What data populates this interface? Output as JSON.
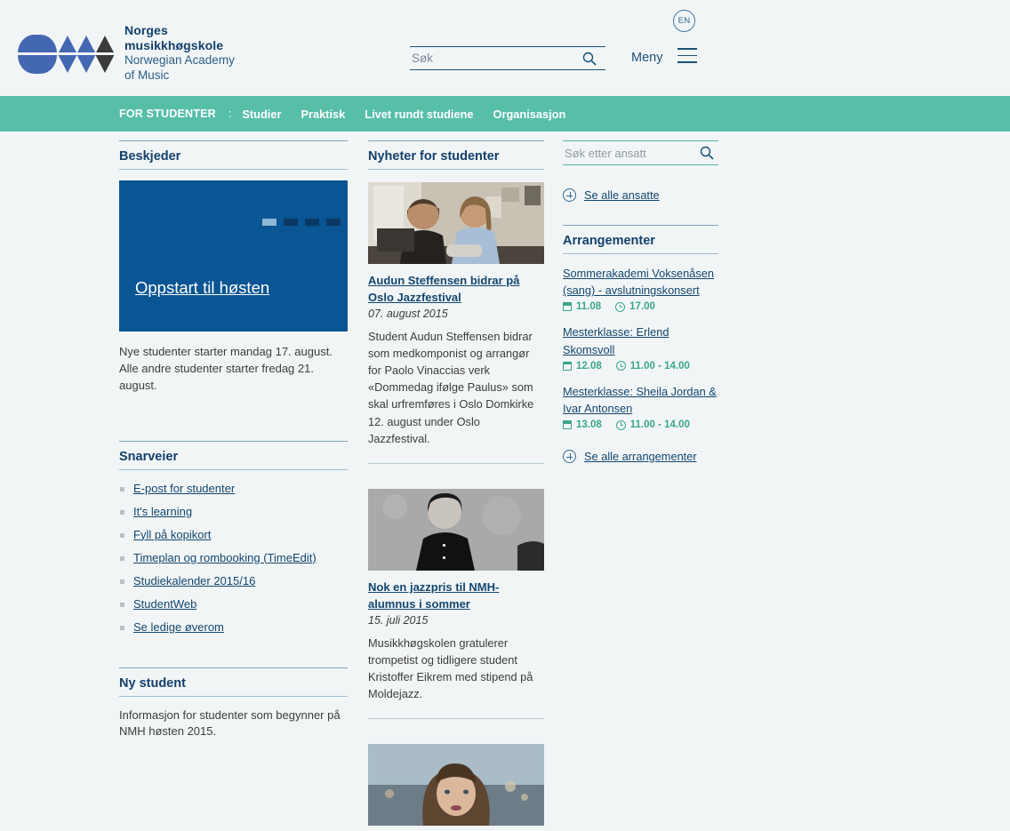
{
  "header": {
    "logo": {
      "line1": "Norges",
      "line2": "musikkhøgskole",
      "line3": "Norwegian Academy",
      "line4": "of Music",
      "mark_icon": "nmh-logo-icon"
    },
    "search": {
      "placeholder": "Søk",
      "value": "",
      "icon": "search-icon"
    },
    "menu_label": "Meny",
    "menu_icon": "hamburger-icon",
    "language_badge": "EN"
  },
  "navbar": {
    "section_title": "FOR STUDENTER",
    "separator": ":",
    "items": [
      {
        "label": "Studier"
      },
      {
        "label": "Praktisk"
      },
      {
        "label": "Livet rundt studiene"
      },
      {
        "label": "Organisasjon"
      }
    ]
  },
  "left": {
    "messages_heading": "Beskjeder",
    "promo": {
      "link_text": "Oppstart til høsten",
      "slides": 4,
      "active_slide": 1,
      "description": "Nye studenter starter mandag 17. august. Alle andre studenter starter fredag 21. august."
    },
    "shortcuts_heading": "Snarveier",
    "shortcuts": [
      {
        "label": "E-post for studenter"
      },
      {
        "label": "It's learning"
      },
      {
        "label": "Fyll på kopikort"
      },
      {
        "label": "Timeplan og rombooking (TimeEdit)"
      },
      {
        "label": "Studiekalender 2015/16"
      },
      {
        "label": "StudentWeb"
      },
      {
        "label": "Se ledige øverom"
      }
    ],
    "new_student_heading": "Ny student",
    "new_student_text": "Informasjon for studenter som begynner på NMH høsten 2015."
  },
  "middle": {
    "heading": "Nyheter for studenter",
    "articles": [
      {
        "title": "Audun Steffensen bidrar på Oslo Jazzfestival",
        "date": "07. august 2015",
        "body": "Student Audun Steffensen bidrar som medkomponist og arrangør for Paolo Vinaccias verk «Dommedag ifølge Paulus» som skal urfremføres i Oslo Domkirke 12. august under Oslo Jazzfestival.",
        "image": "two-men-at-desk-with-laptop-photo"
      },
      {
        "title": "Nok en jazzpris til NMH-alumnus i sommer",
        "date": "15. juli 2015",
        "body": "Musikkhøgskolen gratulerer trompetist og tidligere student Kristoffer Eikrem med stipend på Moldejazz.",
        "image": "black-white-portrait-man-black-shirt-photo"
      },
      {
        "title": "",
        "date": "",
        "body": "",
        "image": "portrait-woman-with-bangs-outdoors-photo"
      }
    ]
  },
  "right": {
    "employee_search": {
      "placeholder": "Søk etter ansatt",
      "value": "",
      "icon": "search-icon"
    },
    "all_employees_link": "Se alle ansatte",
    "events_heading": "Arrangementer",
    "events": [
      {
        "title": "Sommerakademi Voksenåsen (sang) - avslutningskonsert",
        "date": "11.08",
        "time": "17.00"
      },
      {
        "title": "Mesterklasse: Erlend Skomsvoll",
        "date": "12.08",
        "time": "11.00 - 14.00"
      },
      {
        "title": "Mesterklasse: Sheila Jordan & Ivar Antonsen",
        "date": "13.08",
        "time": "11.00 - 14.00"
      }
    ],
    "all_events_link": "Se alle arrangementer"
  },
  "colors": {
    "green_nav": "#57bea8",
    "promo_blue": "#0a5593",
    "link_navy": "#13466f",
    "page_bg": "#f2f5f6",
    "event_teal": "#3aa58c"
  }
}
